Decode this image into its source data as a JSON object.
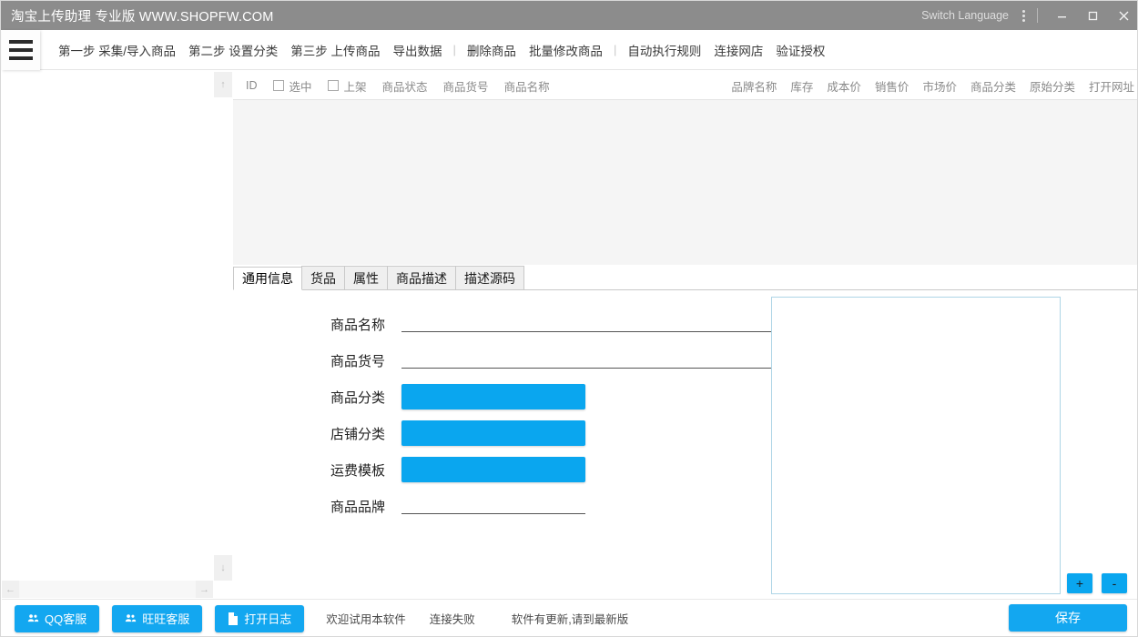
{
  "window": {
    "title": "淘宝上传助理 专业版 WWW.SHOPFW.COM",
    "switch_language": "Switch Language",
    "minimize": "minimize-icon",
    "maximize": "maximize-icon",
    "close": "close-icon",
    "titlebar_bg": "#8c8c8c"
  },
  "menubar": {
    "items": [
      {
        "label": "第一步 采集/导入商品",
        "type": "item"
      },
      {
        "label": "第二步 设置分类",
        "type": "item"
      },
      {
        "label": "第三步 上传商品",
        "type": "item"
      },
      {
        "label": "导出数据",
        "type": "item"
      },
      {
        "label": "|",
        "type": "sep"
      },
      {
        "label": "删除商品",
        "type": "item"
      },
      {
        "label": "批量修改商品",
        "type": "item"
      },
      {
        "label": "|",
        "type": "sep"
      },
      {
        "label": "自动执行规则",
        "type": "item"
      },
      {
        "label": "连接网店",
        "type": "item"
      },
      {
        "label": "验证授权",
        "type": "item"
      }
    ]
  },
  "table": {
    "columns_left": [
      "ID",
      "选中",
      "上架",
      "商品状态",
      "商品货号",
      "商品名称"
    ],
    "columns_right": [
      "品牌名称",
      "库存",
      "成本价",
      "销售价",
      "市场价",
      "商品分类",
      "原始分类",
      "打开网址"
    ],
    "rows": [],
    "body_bg": "#f5f5f5"
  },
  "tabs": [
    {
      "label": "通用信息",
      "active": true
    },
    {
      "label": "货品",
      "active": false
    },
    {
      "label": "属性",
      "active": false
    },
    {
      "label": "商品描述",
      "active": false
    },
    {
      "label": "描述源码",
      "active": false
    }
  ],
  "form": {
    "fields": [
      {
        "label": "商品名称",
        "type": "underline",
        "value": ""
      },
      {
        "label": "商品货号",
        "type": "underline",
        "value": ""
      },
      {
        "label": "商品分类",
        "type": "select",
        "value": ""
      },
      {
        "label": "店铺分类",
        "type": "select",
        "value": ""
      },
      {
        "label": "运费模板",
        "type": "select",
        "value": ""
      },
      {
        "label": "商品品牌",
        "type": "underline-short",
        "value": ""
      }
    ]
  },
  "preview": {
    "add_label": "+",
    "remove_label": "-",
    "border_color": "#aed5e6"
  },
  "bottom": {
    "buttons": [
      {
        "label": "QQ客服",
        "icon": "people-icon"
      },
      {
        "label": "旺旺客服",
        "icon": "people-icon"
      },
      {
        "label": "打开日志",
        "icon": "document-icon"
      }
    ],
    "status": [
      "欢迎试用本软件",
      "连接失败",
      "软件有更新,请到最新版"
    ],
    "save_label": "保存"
  },
  "theme": {
    "accent": "#13a7f0",
    "select_blue": "#0aa6ef"
  }
}
